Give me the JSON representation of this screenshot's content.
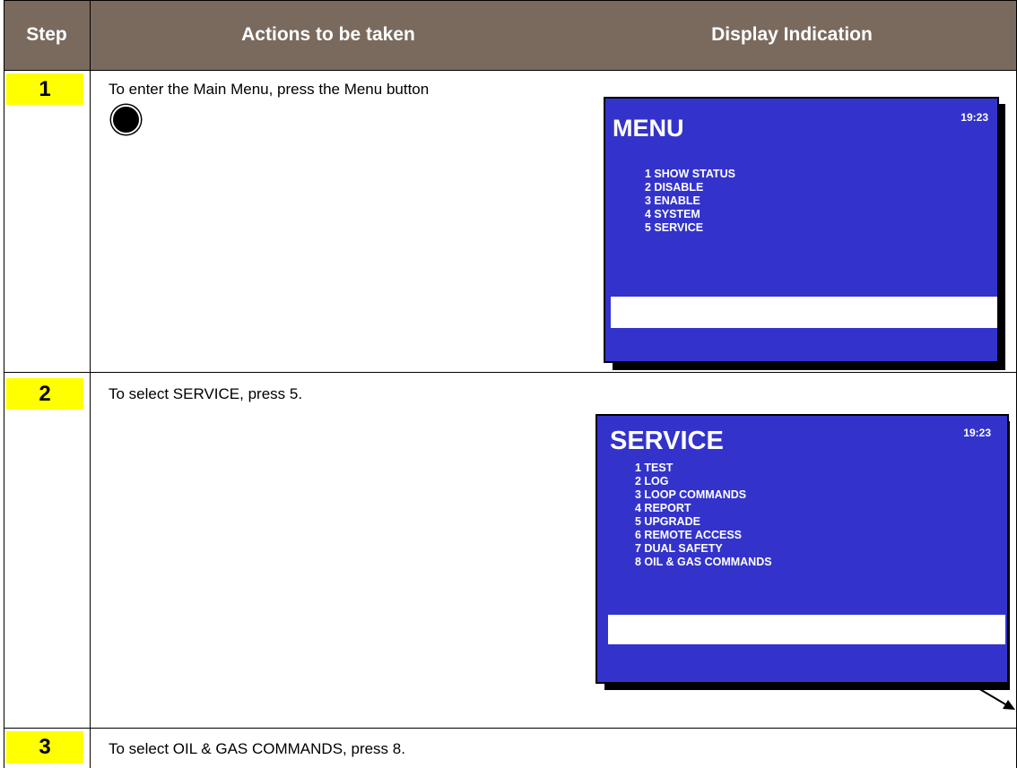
{
  "header": {
    "col_step": "Step",
    "col_actions": "Actions to be taken",
    "col_display": "Display Indication",
    "bg_color": "#7a6a5e"
  },
  "steps": [
    {
      "number": "1",
      "action": "To enter the Main Menu, press the Menu button",
      "button_icon": "menu-button-icon",
      "display": {
        "title": "MENU",
        "time": "19:23",
        "items": [
          "1 SHOW STATUS",
          "2 DISABLE",
          "3 ENABLE",
          "4 SYSTEM",
          "5 SERVICE"
        ]
      }
    },
    {
      "number": "2",
      "action": "To select SERVICE, press 5.",
      "display": {
        "title": "SERVICE",
        "time": "19:23",
        "items": [
          "1 TEST",
          "2 LOG",
          "3 LOOP COMMANDS",
          "4 REPORT",
          "5 UPGRADE",
          "6 REMOTE ACCESS",
          "7 DUAL SAFETY",
          "8 OIL & GAS COMMANDS"
        ]
      }
    },
    {
      "number": "3",
      "action": "To select OIL & GAS COMMANDS, press 8."
    }
  ],
  "colors": {
    "screen": "#3333cc",
    "step_highlight": "#ffff00"
  }
}
